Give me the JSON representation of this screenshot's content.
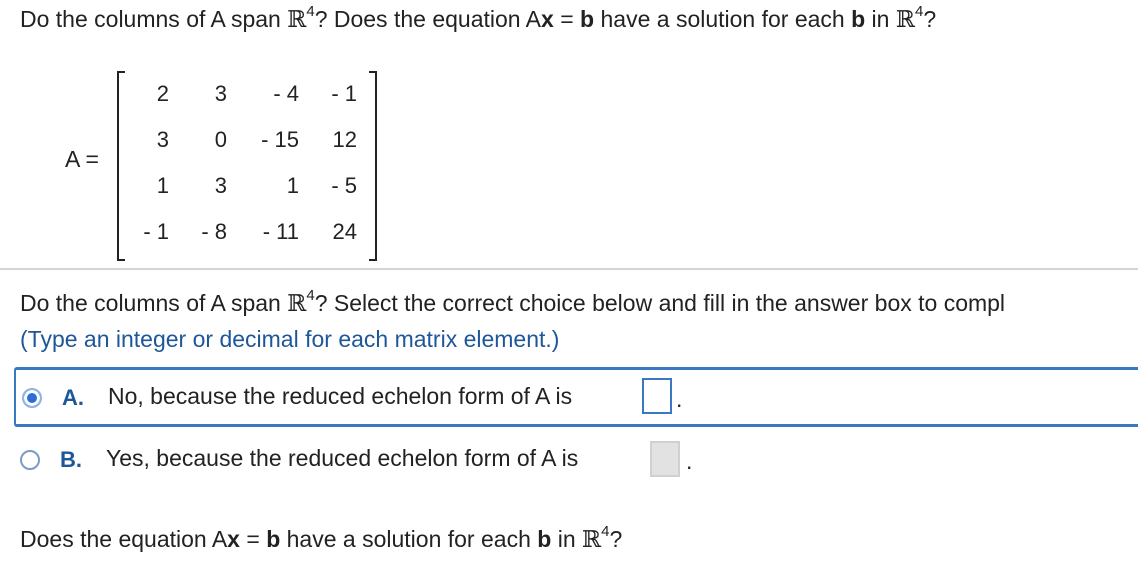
{
  "q1": {
    "part1_pre": "Do the columns of A span ",
    "space": "ℝ",
    "exp": "4",
    "part1_post": "? Does the equation A",
    "x": "x",
    "eq": " = ",
    "b": "b",
    "part2": " have a solution for each ",
    "b2": "b",
    "in": " in ",
    "space2": "ℝ",
    "exp2": "4",
    "end": "?"
  },
  "matrix": {
    "label": "A =",
    "rows": [
      [
        "2",
        "3",
        "- 4",
        "- 1"
      ],
      [
        "3",
        "0",
        "- 15",
        "12"
      ],
      [
        "1",
        "3",
        "1",
        "- 5"
      ],
      [
        "- 1",
        "- 8",
        "- 11",
        "24"
      ]
    ]
  },
  "q2": {
    "pre": "Do the columns of A span ",
    "space": "ℝ",
    "exp": "4",
    "post": "? Select the correct choice below and fill in the answer box to compl"
  },
  "hint": "(Type an integer or decimal for each matrix element.)",
  "choices": [
    {
      "letter": "A.",
      "text": "No, because the reduced echelon form of A is",
      "selected": true,
      "end": "."
    },
    {
      "letter": "B.",
      "text": "Yes, because the reduced echelon form of A is",
      "selected": false,
      "end": "."
    }
  ],
  "q3": {
    "pre": "Does the equation A",
    "x": "x",
    "eq": " = ",
    "b": "b",
    "mid": " have a solution for each ",
    "b2": "b",
    "in": " in ",
    "space": "ℝ",
    "exp": "4",
    "end": "?"
  },
  "colors": {
    "accent": "#3a78c4",
    "link": "#1e5799",
    "divider": "#d4d4d4"
  }
}
